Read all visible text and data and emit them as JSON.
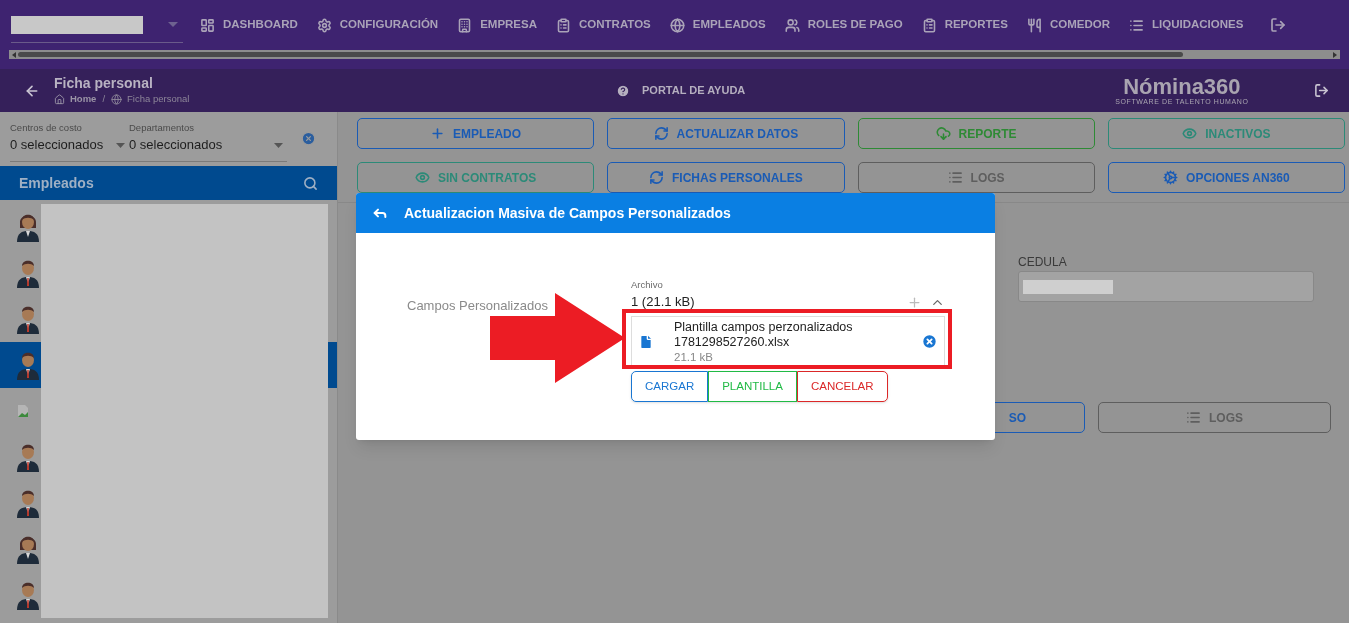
{
  "top_nav": {
    "items": [
      {
        "label": "DASHBOARD"
      },
      {
        "label": "CONFIGURACIÓN"
      },
      {
        "label": "EMPRESA"
      },
      {
        "label": "CONTRATOS"
      },
      {
        "label": "EMPLEADOS"
      },
      {
        "label": "ROLES DE PAGO"
      },
      {
        "label": "REPORTES"
      },
      {
        "label": "COMEDOR"
      },
      {
        "label": "LIQUIDACIONES"
      }
    ]
  },
  "page_header": {
    "title": "Ficha personal",
    "breadcrumb": [
      "Home",
      "Ficha personal"
    ],
    "breadcrumb_separator": "/",
    "help_link": "PORTAL DE AYUDA",
    "logo": {
      "name": "Nómina360",
      "tagline": "SOFTWARE DE TALENTO HUMANO"
    }
  },
  "filters": [
    {
      "label": "Centros de costo",
      "value": "0 seleccionados"
    },
    {
      "label": "Departamentos",
      "value": "0 seleccionados"
    }
  ],
  "employee_list": {
    "title": "Empleados",
    "items": [
      {
        "kind": "female",
        "selected": false
      },
      {
        "kind": "male",
        "selected": false
      },
      {
        "kind": "male",
        "selected": false
      },
      {
        "kind": "male",
        "selected": true
      },
      {
        "kind": "broken",
        "selected": false
      },
      {
        "kind": "male",
        "selected": false
      },
      {
        "kind": "male",
        "selected": false
      },
      {
        "kind": "female",
        "selected": false
      },
      {
        "kind": "male",
        "selected": false
      }
    ]
  },
  "actions": [
    {
      "label": "EMPLEADO",
      "color": "#1a5bb5"
    },
    {
      "label": "ACTUALIZAR DATOS",
      "color": "#1a5bb5"
    },
    {
      "label": "REPORTE",
      "color": "#2e8a35"
    },
    {
      "label": "INACTIVOS",
      "color": "#2c8a78"
    },
    {
      "label": "SIN CONTRATOS",
      "color": "#2c8a78"
    },
    {
      "label": "FICHAS PERSONALES",
      "color": "#1a5bb5"
    },
    {
      "label": "LOGS",
      "color": "#5e5e5e"
    },
    {
      "label": "OPCIONES AN360",
      "color": "#1a5bb5"
    }
  ],
  "background_form": {
    "field_label": "CEDULA",
    "buttons": [
      {
        "label": "SO",
        "color": "#1a5bb5"
      },
      {
        "label": "LOGS",
        "color": "#5e5e5e"
      }
    ]
  },
  "dialog": {
    "title": "Actualizacion Masiva de Campos Personalizados",
    "field_label": "Campos Personalizados",
    "uploader": {
      "caption": "Archivo",
      "summary": "1 (21.1 kB)",
      "file": {
        "name": "Plantilla campos perzonalizados 1781298527260.xlsx",
        "size": "21.1 kB"
      },
      "buttons": [
        {
          "label": "CARGAR",
          "color": "#1976d2"
        },
        {
          "label": "PLANTILLA",
          "color": "#21ba45"
        },
        {
          "label": "CANCELAR",
          "color": "#db2828"
        }
      ]
    }
  }
}
